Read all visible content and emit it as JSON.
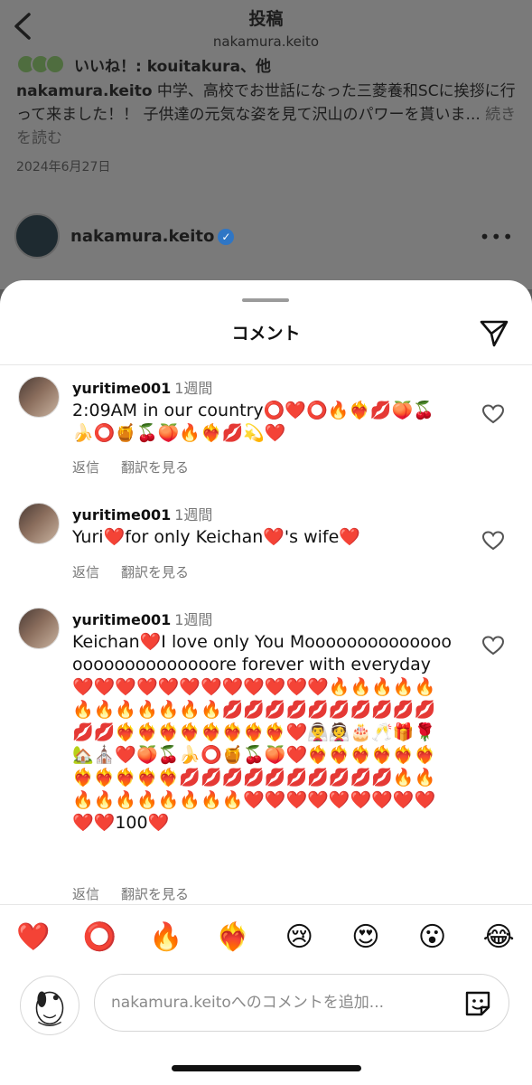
{
  "header": {
    "title": "投稿",
    "subtitle": "nakamura.keito"
  },
  "post": {
    "likes_text": "いいね！: kouitakura、他",
    "caption_user": "nakamura.keito",
    "caption_text": " 中学、高校でお世話になった三菱養和SCに挨拶に行って来ました！！ 子供達の元気な姿を見て沢山のパワーを貰いま...",
    "more_label": " 続きを読む",
    "date": "2024年6月27日",
    "next_author": "nakamura.keito"
  },
  "sheet": {
    "title": "コメント"
  },
  "comments": [
    {
      "user": "yuritime001",
      "time": "1週間",
      "text": "2:09AM in our country⭕❤️⭕🔥❤️‍🔥💋🍑🍒🍌⭕🍯🍒🍑🔥❤️‍🔥💋💫❤️",
      "reply_label": "返信",
      "translate_label": "翻訳を見る"
    },
    {
      "user": "yuritime001",
      "time": "1週間",
      "text": "Yuri❤️for only Keichan❤️'s wife❤️",
      "reply_label": "返信",
      "translate_label": "翻訳を見る"
    },
    {
      "user": "yuritime001",
      "time": "1週間",
      "text": "Keichan❤️I love only You Moooooooooooooooooooooooooooore forever with everyday❤️❤️❤️❤️❤️❤️❤️❤️❤️❤️❤️❤️🔥🔥🔥🔥🔥🔥🔥🔥🔥🔥🔥🔥💋💋💋💋💋💋💋💋💋💋💋💋❤️‍🔥❤️‍🔥❤️‍🔥❤️‍🔥❤️‍🔥❤️‍🔥❤️‍🔥❤️‍🔥❤️👰‍♂️👰🎂🥂🎁🌹🏡⛪❤️🍑🍒🍌⭕🍯🍒🍑❤️❤️‍🔥❤️‍🔥❤️‍🔥❤️‍🔥❤️‍🔥❤️‍🔥❤️‍🔥❤️‍🔥❤️‍🔥❤️‍🔥❤️‍🔥💋💋💋💋💋💋💋💋💋💋🔥🔥🔥🔥🔥🔥🔥🔥🔥🔥❤️❤️❤️❤️❤️❤️❤️❤️❤️❤️❤️100❤️",
      "reply_label": "返信",
      "translate_label": "翻訳を見る"
    }
  ],
  "reactions": [
    "❤️",
    "⭕",
    "🔥",
    "❤️‍🔥",
    "😢",
    "😍",
    "😮",
    "😂"
  ],
  "composer": {
    "placeholder": "nakamura.keitoへのコメントを追加..."
  },
  "colors": {
    "heart_red": "#e0245e",
    "verified_blue": "#2f76c5"
  }
}
